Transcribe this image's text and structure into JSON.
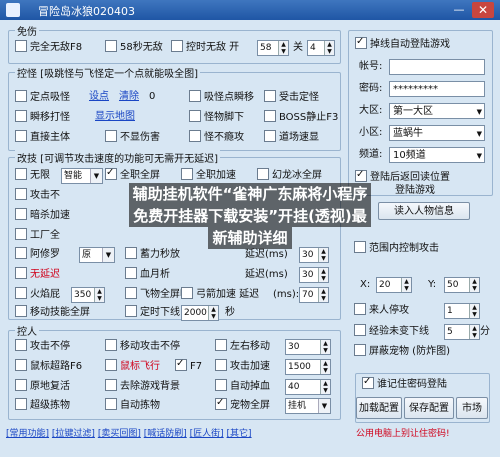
{
  "window": {
    "title": "冒险岛冰狼020403",
    "close": "✕",
    "minimize": "—"
  },
  "invincible": {
    "title": "免伤",
    "full_invincible": "完全无敌F8",
    "invincible_58s": "58秒无敌",
    "timed_invincible": "控时无敌 开",
    "on_value": "58",
    "off_label": "关",
    "off_value": "4"
  },
  "monster": {
    "title": "控怪 [吸跳怪与飞怪定一个点就能吸全图]",
    "fixed_suck": "定点吸怪",
    "set_point": "设点",
    "clear": "清除",
    "zero": "0",
    "monster_follow": "吸怪点瞬移",
    "hit_lock": "受击定怪",
    "instant_move": "瞬移打怪",
    "show_map": "显示地图",
    "monster_under": "怪物脚下",
    "boss_stop": "BOSS静止F3",
    "direct_master": "直接主体",
    "no_damage": "不显伤害",
    "no_fire": "怪不瘾攻",
    "field_speed": "道场速显"
  },
  "attack": {
    "title": "改技 [可调节攻击速度的功能可无需开无延迟]",
    "no_limit": "无限",
    "smart": "智能",
    "all_screen": "全职全屏",
    "all_speedup": "全职加速",
    "ice_screen": "幻龙冰全屏",
    "attack_no": "攻击不",
    "dark_speed": "暗杀加速",
    "worker_screen": "工厂全",
    "ashura": "阿修罗",
    "ashura_sel": "原",
    "wind_boost": "蓄力秒放",
    "no_delay": "无延迟",
    "blood_prev": "血月析",
    "fireball": "火焰屁",
    "fireball_val": "350",
    "fly_screen": "飞物全屏吸",
    "bow_speed": "弓箭加速 延迟",
    "delay1_label": "延迟(ms)",
    "delay1_val": "30",
    "delay2_val": "30",
    "delay3_val": "70",
    "time_next": "定时下线",
    "time_val": "2000",
    "sec": "秒",
    "move_full": "移动技能全屏",
    "ms": "(ms):"
  },
  "control": {
    "title": "控人",
    "attack_no": "攻击不停",
    "move_attack": "移动攻击不停",
    "left_right": "左右移动",
    "left_right_val": "30",
    "mouse_jump": "鼠标超路F6",
    "mouse_fly": "鼠标飞行",
    "f7": "F7",
    "attack_speed": "攻击加速",
    "attack_speed_val": "1500",
    "fast_revive": "原地复活",
    "remove_bg": "去除游戏背景",
    "auto_hp": "自动掉血",
    "auto_hp_val": "40",
    "super_grab": "超级拣物",
    "auto_grab": "自动拣物",
    "pet_screen": "宠物全屏",
    "pet_sel": "挂机"
  },
  "right": {
    "auto_login": "掉线自动登陆游戏",
    "account_label": "帐号:",
    "account_val": "",
    "password_label": "密码:",
    "password_val": "*********",
    "region_label": "大区:",
    "region_val": "第一大区",
    "zone_label": "小区:",
    "zone_val": "蓝蜗牛",
    "channel_label": "频道:",
    "channel_val": "10频道",
    "return_origin": "登陆后返回读位置",
    "auto_login_game": "登陆游戏",
    "load_info": "读入人物信息",
    "attack_range": "范围内控制攻击",
    "x_label": "X:",
    "x_val": "20",
    "y_label": "Y:",
    "y_val": "50",
    "stop_visit": "来人停攻",
    "stop_visit_val": "1",
    "exp_down": "经验未变下线",
    "exp_down_val": "5",
    "minutes": "分",
    "block_pet": "屏蔽宠物 (防炸图)",
    "remember_pwd": "谁记住密码登陆",
    "load_config": "加载配置",
    "save_config": "保存配置",
    "market": "市场",
    "warn": "公用电脑上别让住密码!"
  },
  "bottom": {
    "links": [
      "[常用功能]",
      "[拉键过滤]",
      "[卖买回图]",
      "[喊话防刷]",
      "[匠人街]",
      "[其它]"
    ]
  },
  "overlay": {
    "line1": "辅助挂机软件“雀神广东麻将小程序",
    "line2": "免费开挂器下载安装”开挂(透视)最",
    "line3": "新辅助详细"
  }
}
